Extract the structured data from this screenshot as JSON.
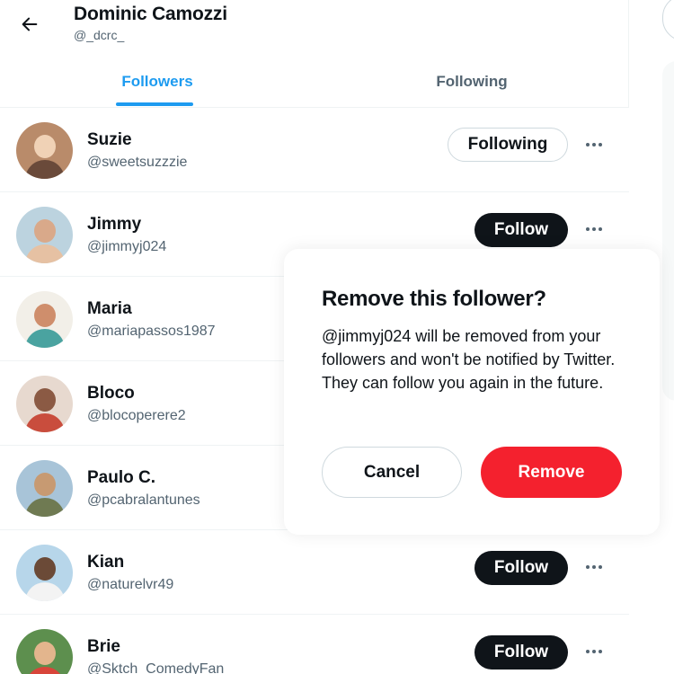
{
  "colors": {
    "accent": "#1d9bf0",
    "follow_button": "#0f1419",
    "remove_button": "#f4212e",
    "secondary_text": "#536471"
  },
  "header": {
    "back_icon": "arrow-left-icon",
    "title": "Dominic Camozzi",
    "handle": "@_dcrc_"
  },
  "tabs": [
    {
      "label": "Followers",
      "active": true
    },
    {
      "label": "Following",
      "active": false
    }
  ],
  "followers": [
    {
      "name": "Suzie",
      "handle": "@sweetsuzzzie",
      "button": "Following",
      "avatar_colors": [
        "#b98b6a",
        "#f0d2b6",
        "#6a4a3a"
      ]
    },
    {
      "name": "Jimmy",
      "handle": "@jimmyj024",
      "button": "Follow",
      "avatar_colors": [
        "#bcd3df",
        "#d9a98a",
        "#e6c1a3"
      ]
    },
    {
      "name": "Maria",
      "handle": "@mariapassos1987",
      "button": "",
      "avatar_colors": [
        "#f2efe8",
        "#cf8e6c",
        "#4aa3a0"
      ]
    },
    {
      "name": "Bloco",
      "handle": "@blocoperere2",
      "button": "",
      "avatar_colors": [
        "#e7d9cf",
        "#8b5a44",
        "#c94d3d"
      ]
    },
    {
      "name": "Paulo C.",
      "handle": "@pcabralantunes",
      "button": "",
      "avatar_colors": [
        "#a8c4d8",
        "#c79a72",
        "#6f7a52"
      ]
    },
    {
      "name": "Kian",
      "handle": "@naturelvr49",
      "button": "Follow",
      "avatar_colors": [
        "#b7d6ea",
        "#6b4a37",
        "#f3f3f3"
      ]
    },
    {
      "name": "Brie",
      "handle": "@Sktch_ComedyFan",
      "button": "Follow",
      "avatar_colors": [
        "#5d8f4e",
        "#e3b58d",
        "#d8453a"
      ]
    }
  ],
  "more_icon": "more-horizontal-icon",
  "modal": {
    "title": "Remove this follower?",
    "body": "@jimmyj024 will be removed from your followers and won't be notified by Twitter. They can follow you again in the future.",
    "cancel_label": "Cancel",
    "remove_label": "Remove"
  }
}
